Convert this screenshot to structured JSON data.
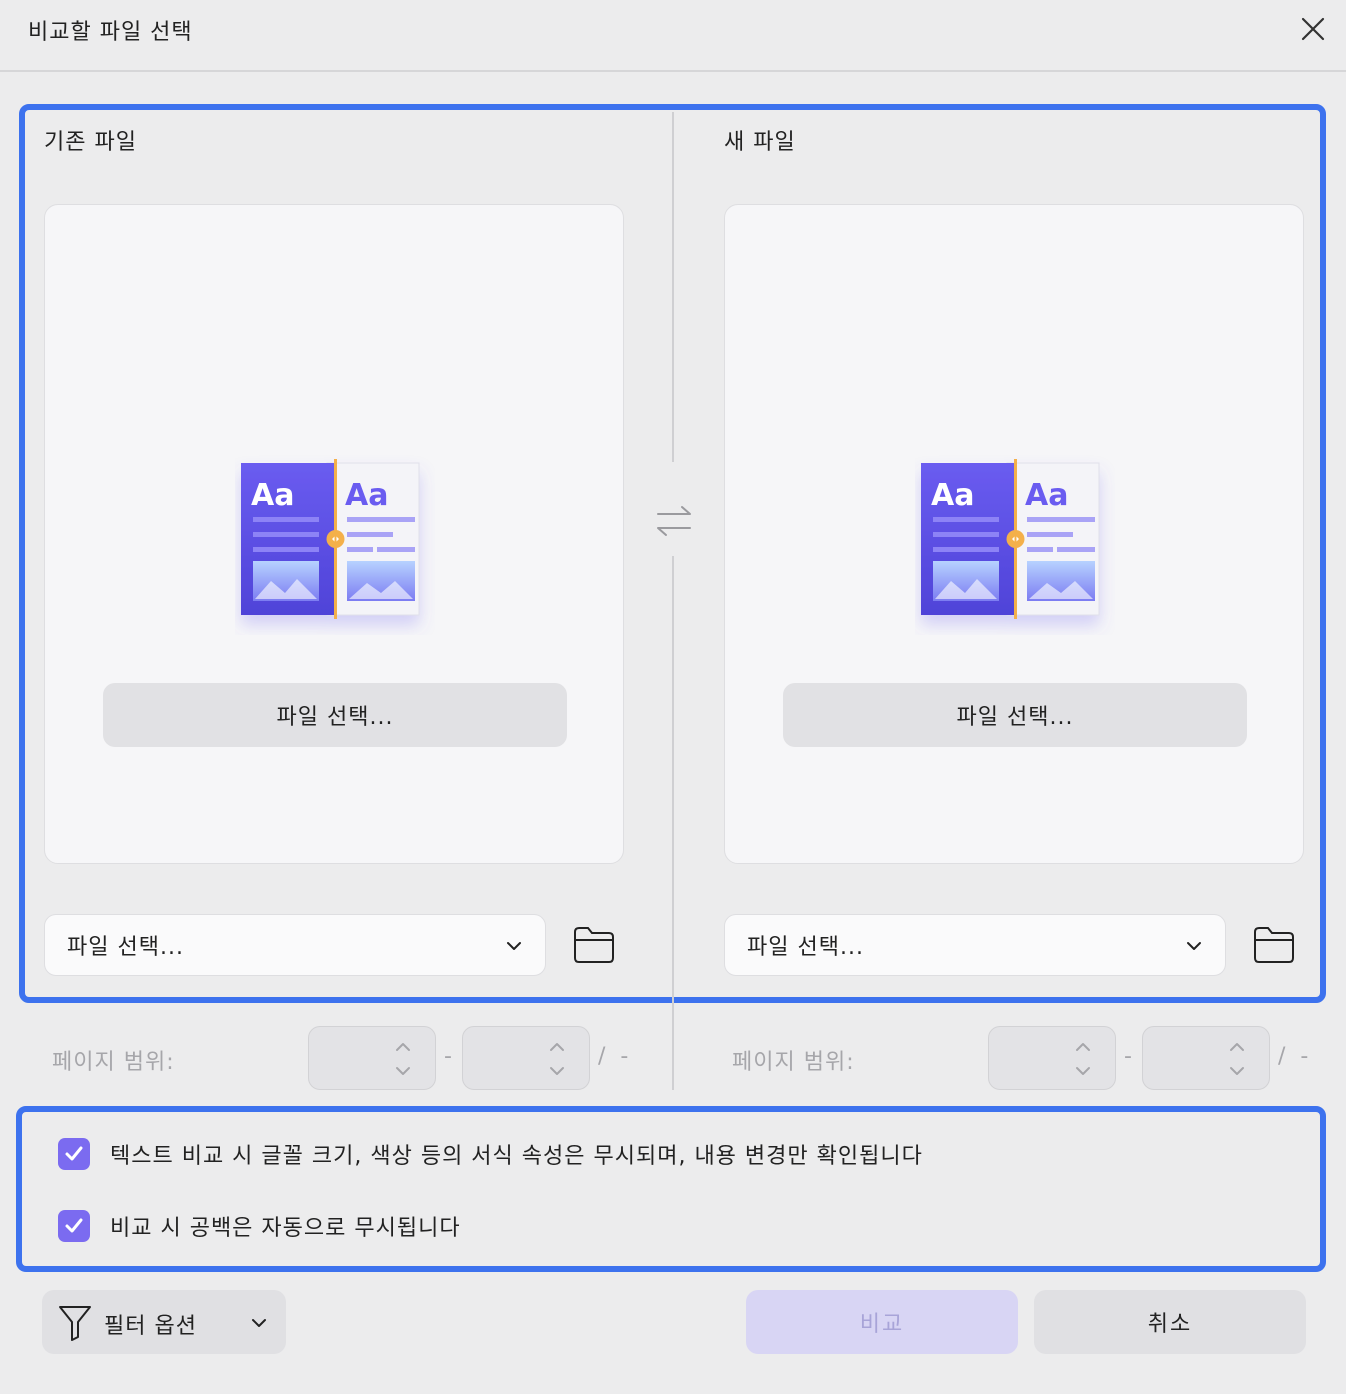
{
  "dialog": {
    "title": "비교할 파일 선택"
  },
  "old_file": {
    "heading": "기존 파일",
    "select_button": "파일 선택...",
    "dropdown_value": "파일 선택...",
    "page_range_label": "페이지 범위:",
    "range_separator": "-",
    "page_total": "/ -"
  },
  "new_file": {
    "heading": "새 파일",
    "select_button": "파일 선택...",
    "dropdown_value": "파일 선택...",
    "page_range_label": "페이지 범위:",
    "range_separator": "-",
    "page_total": "/ -"
  },
  "illustration": {
    "left_text": "Aa",
    "right_text": "Aa"
  },
  "options": {
    "ignore_formatting": "텍스트 비교 시 글꼴 크기, 색상 등의 서식 속성은 무시되며, 내용 변경만 확인됩니다",
    "ignore_whitespace": "비교 시 공백은 자동으로 무시됩니다"
  },
  "footer": {
    "filter_label": "필터 옵션",
    "compare_label": "비교",
    "cancel_label": "취소"
  },
  "colors": {
    "accent_border": "#3d72ee",
    "checkbox": "#7b6bf0",
    "compare_disabled": "#d8d5f4"
  },
  "icons": [
    "close-icon",
    "swap-icon",
    "chevron-down-icon",
    "folder-icon",
    "checkmark-icon",
    "filter-icon"
  ]
}
